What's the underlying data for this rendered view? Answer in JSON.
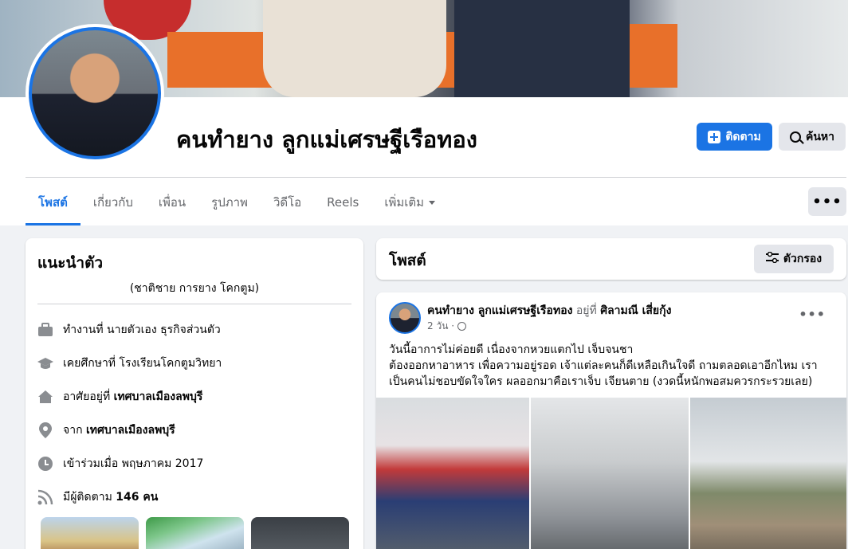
{
  "profile": {
    "name": "คนทำยาง ลูกแม่เศรษฐีเรือทอง",
    "follow_label": "ติดตาม",
    "search_label": "ค้นหา",
    "more_label": "•••"
  },
  "tabs": [
    {
      "label": "โพสต์"
    },
    {
      "label": "เกี่ยวกับ"
    },
    {
      "label": "เพื่อน"
    },
    {
      "label": "รูปภาพ"
    },
    {
      "label": "วิดีโอ"
    },
    {
      "label": "Reels"
    },
    {
      "label": "เพิ่มเติม"
    }
  ],
  "intro": {
    "title": "แนะนำตัว",
    "bio": "(ชาติชาย การยาง โคกตูม)",
    "work": "ทำงานที่ นายตัวเอง ธุรกิจส่วนตัว",
    "study": "เคยศึกษาที่ โรงเรียนโคกตูมวิทยา",
    "lives_prefix": "อาศัยอยู่ที่",
    "lives_place": "เทศบาลเมืองลพบุรี",
    "from_prefix": "จาก",
    "from_place": "เทศบาลเมืองลพบุรี",
    "joined": "เข้าร่วมเมื่อ พฤษภาคม 2017",
    "followers_prefix": "มีผู้ติดตาม",
    "followers_count": "146 คน"
  },
  "posts": {
    "title": "โพสต์",
    "filter_label": "ตัวกรอง"
  },
  "post": {
    "author": "คนทำยาง ลูกแม่เศรษฐีเรือทอง",
    "at": "อยู่ที่",
    "location": "ศิลามณี เสี่ยกุ้ง",
    "time": "2 วัน ·",
    "menu": "•••",
    "line1": "วันนี้อาการไม่ค่อยดี เนื่องจากหวยแตกไป เจ็บจนชา",
    "line2": "ต้องออกหาอาหาร เพื่อความอยู่รอด เจ้าแต่ละคนก็ดีเหลือเกินใจดี ถามตลอดเอาอีกไหม เรา",
    "line3": "เป็นคนไม่ชอบขัดใจใคร ผลออกมาคือเราเจ็บ เจียนตาย (งวดนี้หนักพอสมควรกระรวยเลย)"
  },
  "colors": {
    "accent": "#1b74e4",
    "secondary_text": "#65676b",
    "button_gray": "#e4e6eb",
    "background": "#f0f2f5"
  }
}
